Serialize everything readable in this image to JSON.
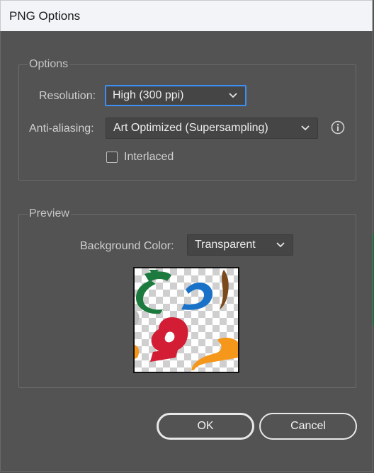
{
  "window": {
    "title": "PNG Options"
  },
  "options_group": {
    "title": "Options",
    "resolution": {
      "label": "Resolution:",
      "value": "High (300 ppi)"
    },
    "anti_aliasing": {
      "label": "Anti-aliasing:",
      "value": "Art Optimized (Supersampling)"
    },
    "interlaced": {
      "label": "Interlaced",
      "checked": false
    }
  },
  "preview_group": {
    "title": "Preview",
    "background_color": {
      "label": "Background Color:",
      "value": "Transparent"
    }
  },
  "buttons": {
    "ok": "OK",
    "cancel": "Cancel"
  },
  "colors": {
    "dialog_bg": "#535353",
    "focus": "#3d8ff5",
    "text": "#d6d6d6"
  },
  "icons": [
    "chevron-down-icon",
    "info-icon",
    "checkbox-icon"
  ]
}
